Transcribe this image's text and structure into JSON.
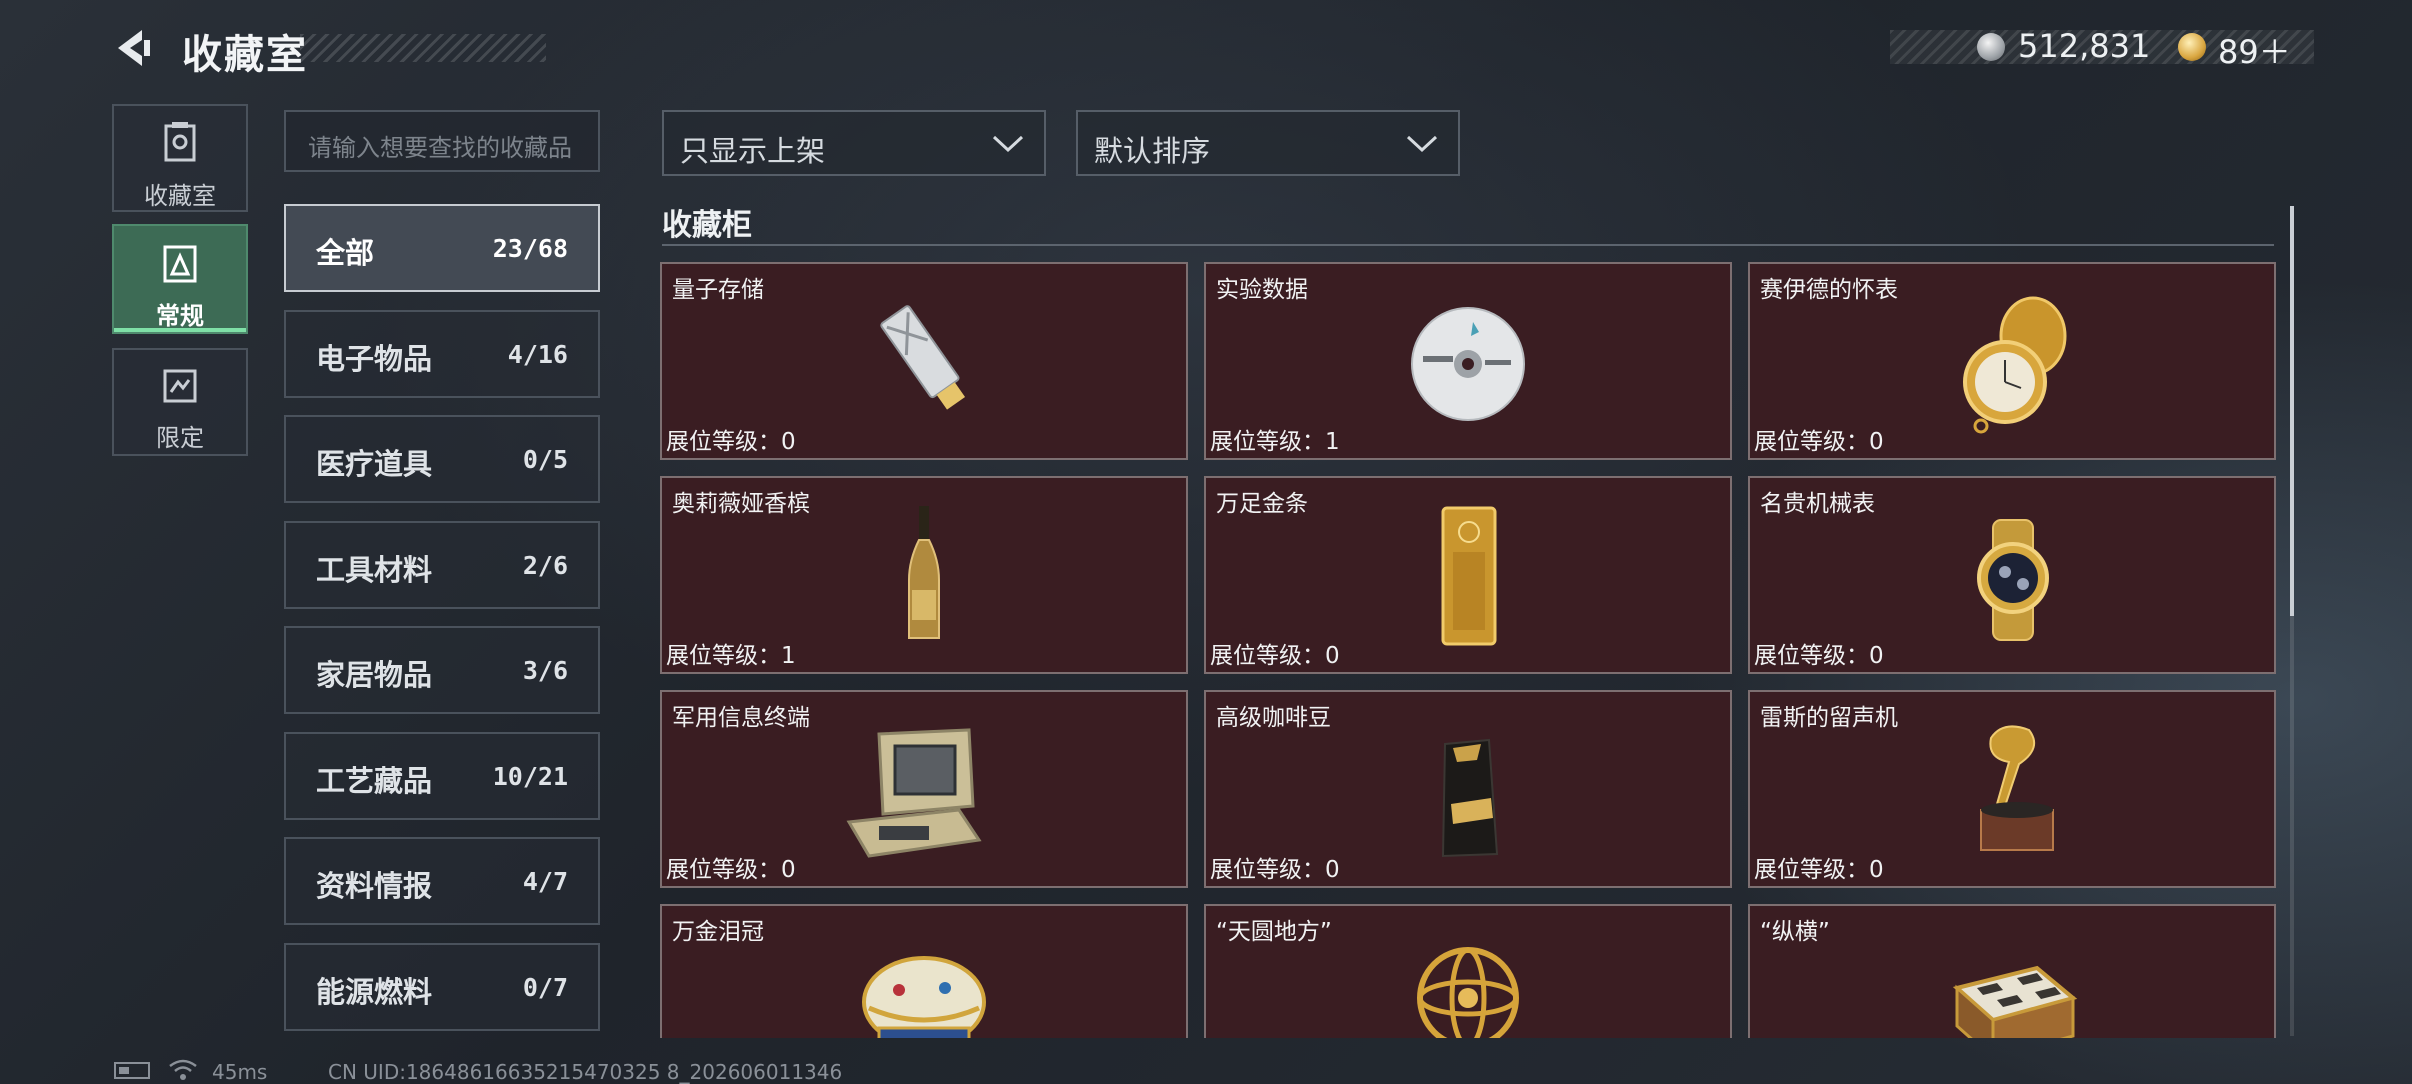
{
  "header": {
    "title": "收藏室"
  },
  "currency": {
    "silver": "512,831",
    "gold": "89＋"
  },
  "nav": [
    {
      "label": "收藏室",
      "icon": "collection-room-icon"
    },
    {
      "label": "常规",
      "icon": "regular-icon",
      "active": true
    },
    {
      "label": "限定",
      "icon": "limited-icon"
    }
  ],
  "search": {
    "placeholder": "请输入想要查找的收藏品"
  },
  "categories": [
    {
      "name": "全部",
      "count": "23/68",
      "active": true
    },
    {
      "name": "电子物品",
      "count": "4/16"
    },
    {
      "name": "医疗道具",
      "count": "0/5"
    },
    {
      "name": "工具材料",
      "count": "2/6"
    },
    {
      "name": "家居物品",
      "count": "3/6"
    },
    {
      "name": "工艺藏品",
      "count": "10/21"
    },
    {
      "name": "资料情报",
      "count": "4/7"
    },
    {
      "name": "能源燃料",
      "count": "0/7"
    }
  ],
  "filters": {
    "display": "只显示上架",
    "sort": "默认排序"
  },
  "section": {
    "title": "收藏柜"
  },
  "items": [
    {
      "name": "量子存储",
      "level": "展位等级：0",
      "icon": "usb-drive-icon"
    },
    {
      "name": "实验数据",
      "level": "展位等级：1",
      "icon": "disc-icon"
    },
    {
      "name": "赛伊德的怀表",
      "level": "展位等级：0",
      "icon": "pocket-watch-icon"
    },
    {
      "name": "奥莉薇娅香槟",
      "level": "展位等级：1",
      "icon": "champagne-icon"
    },
    {
      "name": "万足金条",
      "level": "展位等级：0",
      "icon": "gold-bar-icon"
    },
    {
      "name": "名贵机械表",
      "level": "展位等级：0",
      "icon": "wristwatch-icon"
    },
    {
      "name": "军用信息终端",
      "level": "展位等级：0",
      "icon": "terminal-case-icon"
    },
    {
      "name": "高级咖啡豆",
      "level": "展位等级：0",
      "icon": "coffee-bag-icon"
    },
    {
      "name": "雷斯的留声机",
      "level": "展位等级：0",
      "icon": "gramophone-icon"
    },
    {
      "name": "万金泪冠",
      "level": "",
      "icon": "jeweled-egg-icon"
    },
    {
      "name": "“天圆地方”",
      "level": "",
      "icon": "armillary-sphere-icon"
    },
    {
      "name": "“纵横”",
      "level": "",
      "icon": "chess-box-icon"
    }
  ],
  "status": {
    "ping": "45ms",
    "uid": "CN UID:18648616635215470325 8_202606011346"
  }
}
